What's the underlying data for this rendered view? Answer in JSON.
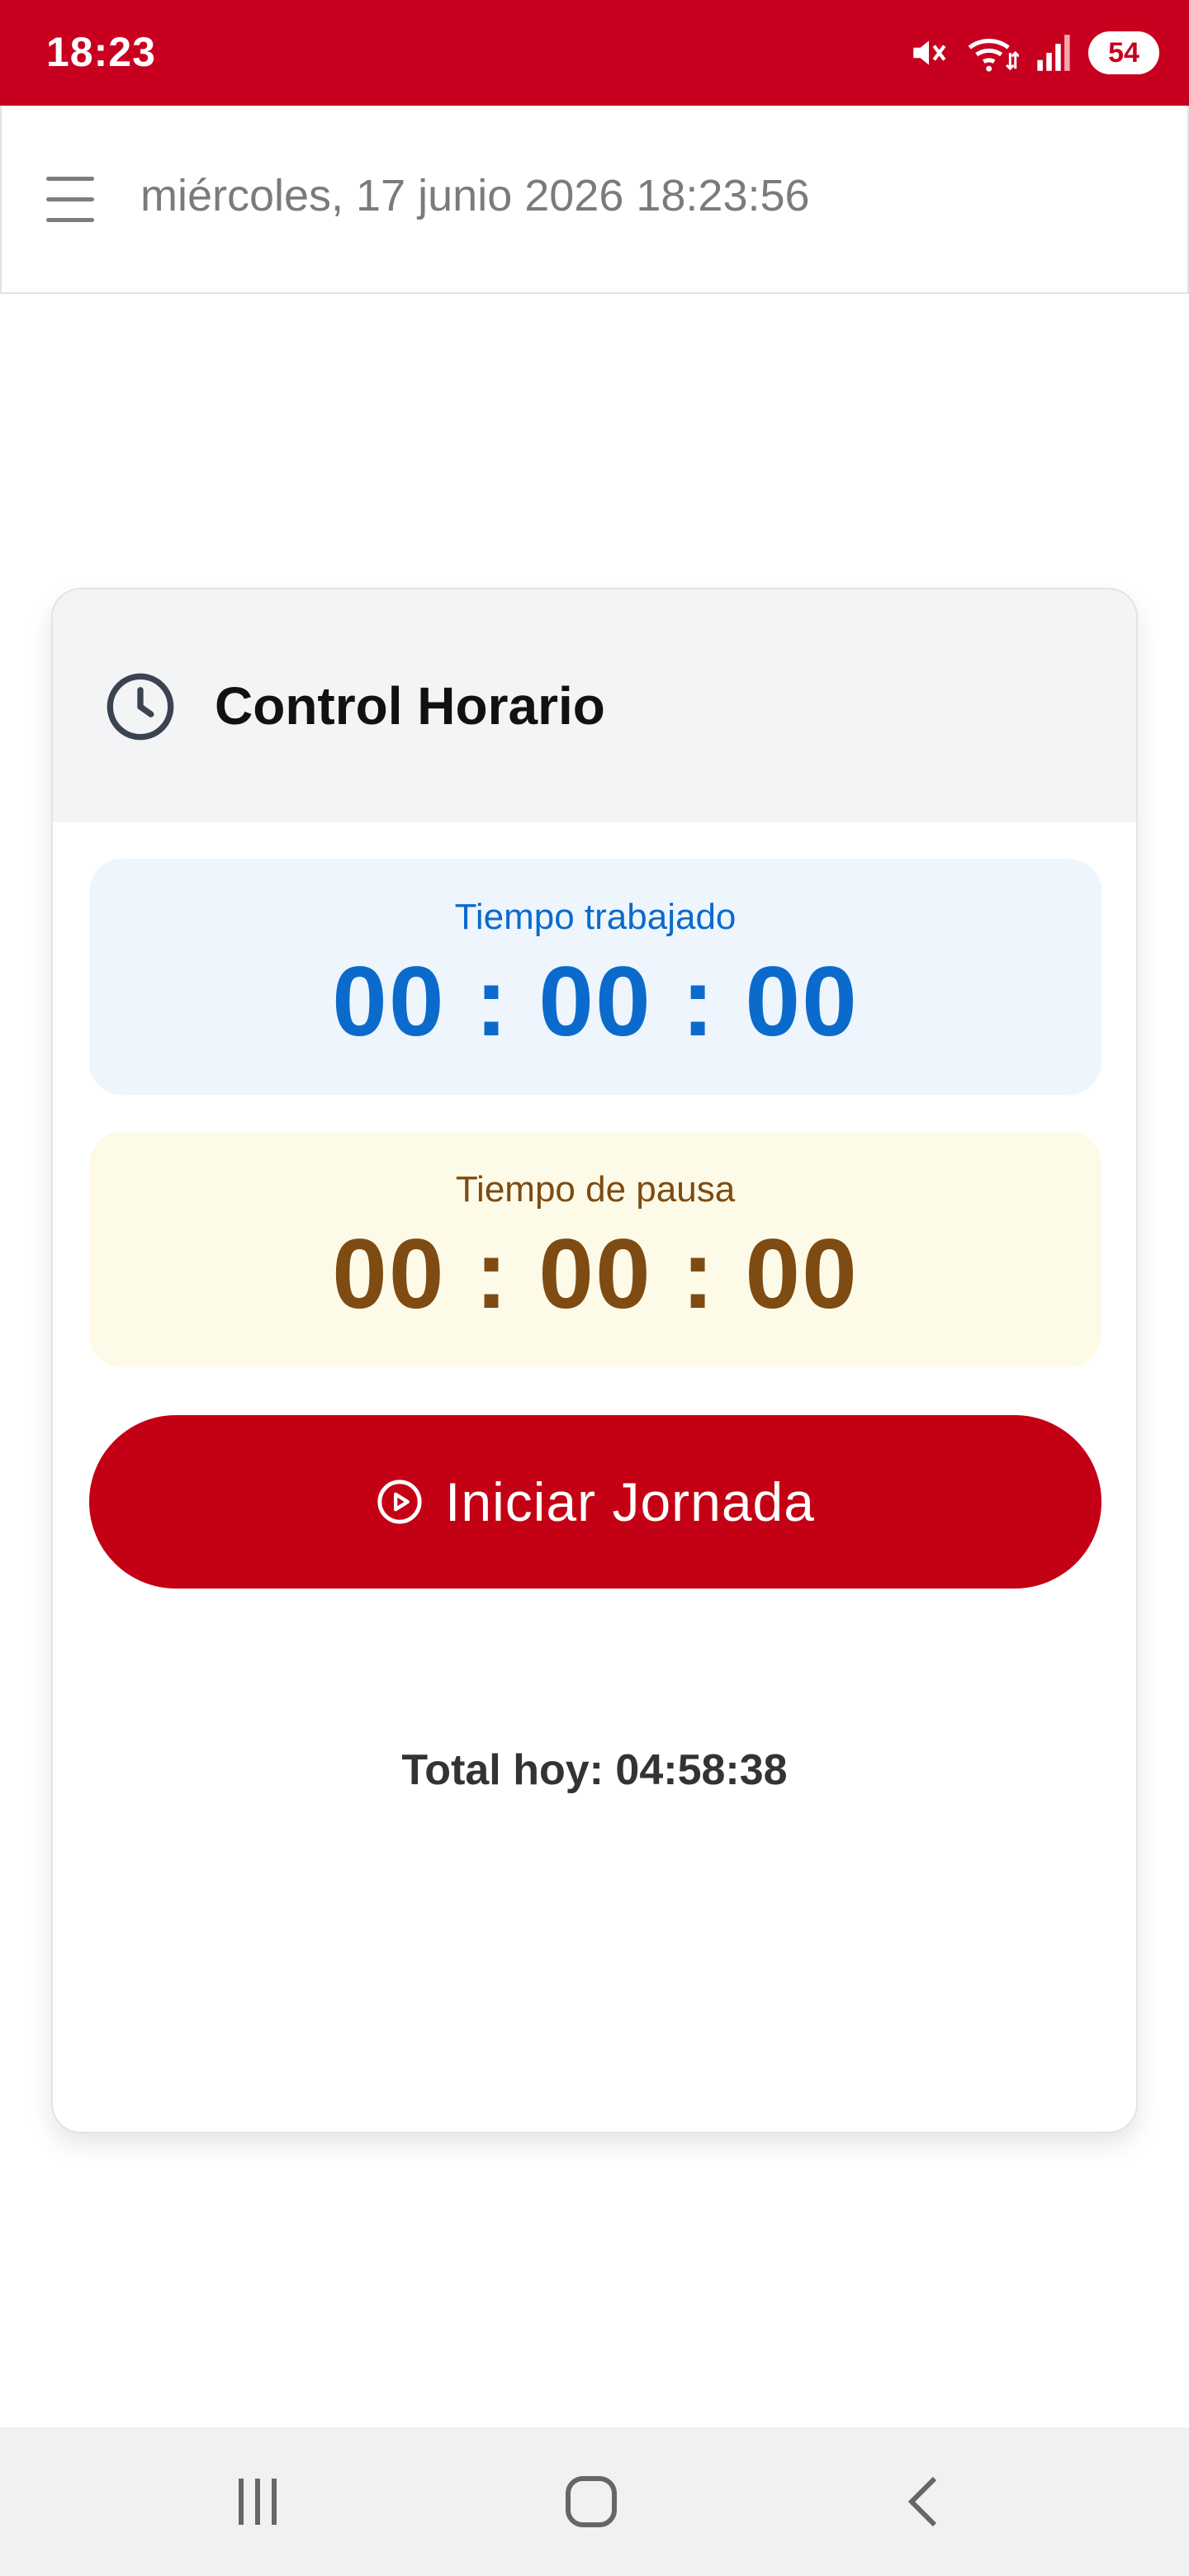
{
  "status_bar": {
    "time": "18:23",
    "icons": [
      "mute-icon",
      "wifi-icon",
      "signal-icon"
    ],
    "battery": "54",
    "background": "#c8001f"
  },
  "header": {
    "datetime": "miércoles, 17 junio 2026 18:23:56",
    "menu_icon": "hamburger-menu-icon"
  },
  "card": {
    "icon": "clock-icon",
    "title": "Control Horario",
    "worked": {
      "label": "Tiempo trabajado",
      "value": "00 : 00 : 00",
      "color": "#0b6bcc"
    },
    "pause": {
      "label": "Tiempo de pausa",
      "value": "00 : 00 : 00",
      "color": "#7e4b12"
    },
    "start_button": {
      "label": "Iniciar Jornada",
      "icon": "play-circle-icon",
      "color": "#c40014"
    },
    "total_today": "Total hoy: 04:58:38"
  },
  "nav_bar": {
    "buttons": [
      "recents-icon",
      "home-icon",
      "back-icon"
    ]
  }
}
